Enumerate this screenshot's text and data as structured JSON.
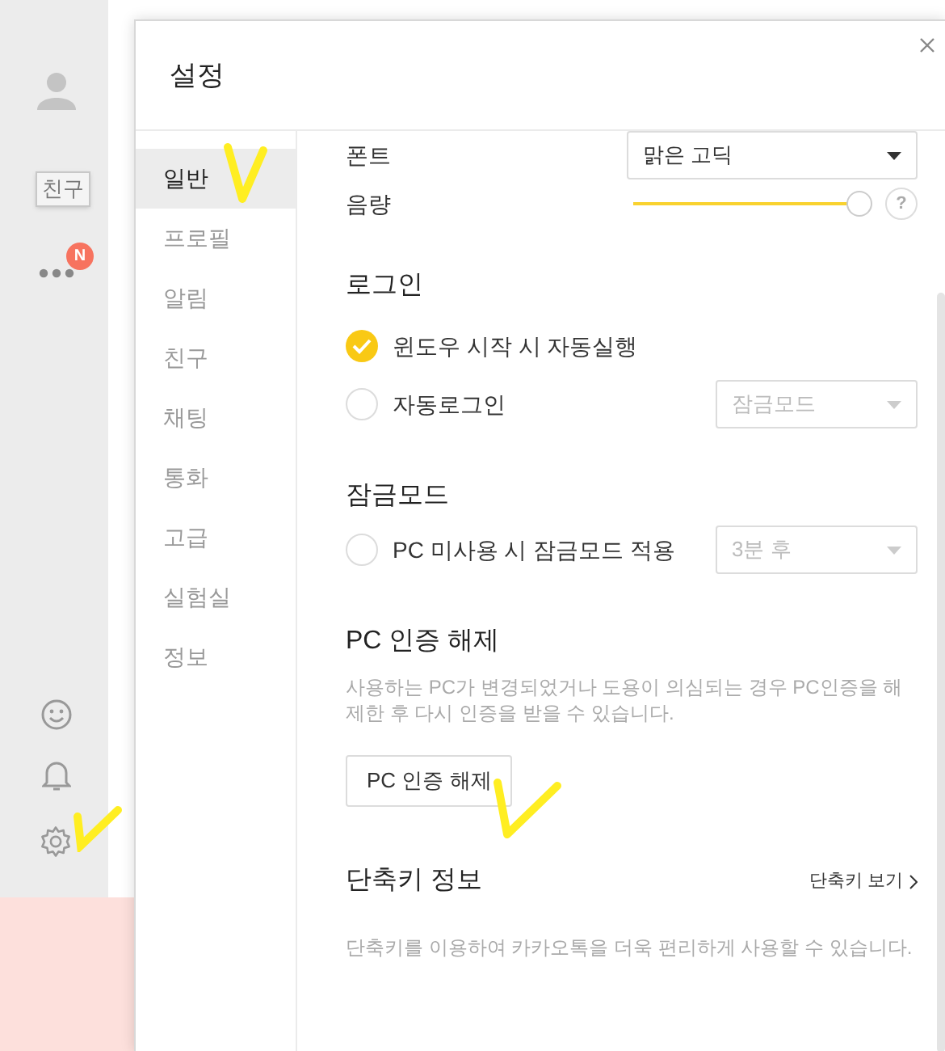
{
  "sidebar": {
    "badge": "N",
    "tooltip": "친구"
  },
  "dialog": {
    "title": "설정",
    "nav": [
      {
        "label": "일반",
        "selected": true
      },
      {
        "label": "프로필",
        "selected": false
      },
      {
        "label": "알림",
        "selected": false
      },
      {
        "label": "친구",
        "selected": false
      },
      {
        "label": "채팅",
        "selected": false
      },
      {
        "label": "통화",
        "selected": false
      },
      {
        "label": "고급",
        "selected": false
      },
      {
        "label": "실험실",
        "selected": false
      },
      {
        "label": "정보",
        "selected": false
      }
    ],
    "font": {
      "label": "폰트",
      "value": "맑은 고딕"
    },
    "volume": {
      "label": "음량",
      "level": 1,
      "help": "?"
    },
    "login": {
      "heading": "로그인",
      "options": [
        {
          "label": "윈도우 시작 시 자동실행",
          "checked": true
        },
        {
          "label": "자동로그인",
          "checked": false,
          "dropdown": {
            "value": "잠금모드",
            "disabled": true
          }
        }
      ]
    },
    "lock_mode": {
      "heading": "잠금모드",
      "options": [
        {
          "label": "PC 미사용 시 잠금모드 적용",
          "checked": false,
          "dropdown": {
            "value": "3분 후",
            "disabled": true
          }
        }
      ]
    },
    "pc_auth": {
      "heading": "PC 인증 해제",
      "description": "사용하는 PC가 변경되었거나 도용이 의심되는 경우 PC인증을 해제한 후 다시 인증을 받을 수 있습니다.",
      "button": "PC 인증 해제"
    },
    "shortcuts": {
      "heading": "단축키 정보",
      "link": "단축키 보기",
      "description": "단축키를 이용하여 카카오톡을 더욱 편리하게 사용할 수 있습니다."
    }
  }
}
